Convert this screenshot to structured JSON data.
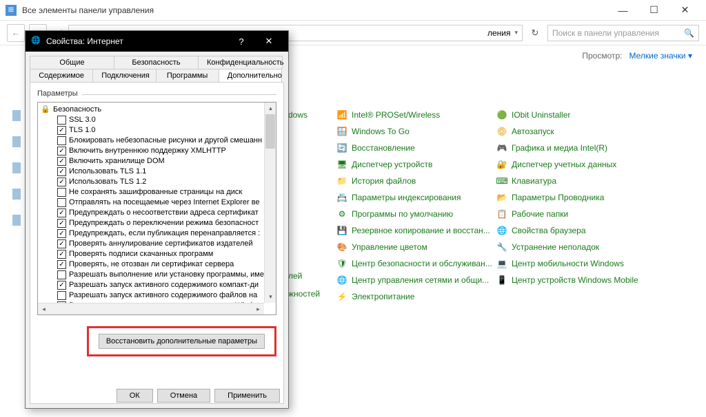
{
  "cp": {
    "title": "Все элементы панели управления",
    "addr_tail": "ления",
    "search_placeholder": "Поиск в панели управления",
    "view_label": "Просмотр:",
    "view_value": "Мелкие значки",
    "cut_items": [
      "dows",
      "",
      "",
      "",
      "",
      "",
      "",
      "",
      "",
      "лей",
      "жностей",
      "",
      ""
    ],
    "col1": [
      {
        "icon": "📶",
        "label": "Intel® PROSet/Wireless"
      },
      {
        "icon": "🪟",
        "label": "Windows To Go"
      },
      {
        "icon": "🔄",
        "label": "Восстановление"
      },
      {
        "icon": "🖥",
        "label": "Диспетчер устройств"
      },
      {
        "icon": "📁",
        "label": "История файлов"
      },
      {
        "icon": "📇",
        "label": "Параметры индексирования"
      },
      {
        "icon": "⚙",
        "label": "Программы по умолчанию"
      },
      {
        "icon": "💾",
        "label": "Резервное копирование и восстан..."
      },
      {
        "icon": "🎨",
        "label": "Управление цветом"
      },
      {
        "icon": "🛡",
        "label": "Центр безопасности и обслуживан..."
      },
      {
        "icon": "🌐",
        "label": "Центр управления сетями и общи..."
      },
      {
        "icon": "⚡",
        "label": "Электропитание"
      }
    ],
    "col2": [
      {
        "icon": "🟢",
        "label": "IObit Uninstaller"
      },
      {
        "icon": "📀",
        "label": "Автозапуск"
      },
      {
        "icon": "🎮",
        "label": "Графика и медиа Intel(R)"
      },
      {
        "icon": "🔐",
        "label": "Диспетчер учетных данных"
      },
      {
        "icon": "⌨",
        "label": "Клавиатура"
      },
      {
        "icon": "📂",
        "label": "Параметры Проводника"
      },
      {
        "icon": "📋",
        "label": "Рабочие папки"
      },
      {
        "icon": "🌐",
        "label": "Свойства браузера"
      },
      {
        "icon": "🔧",
        "label": "Устранение неполадок"
      },
      {
        "icon": "💻",
        "label": "Центр мобильности Windows"
      },
      {
        "icon": "📱",
        "label": "Центр устройств Windows Mobile"
      }
    ]
  },
  "dlg": {
    "title": "Свойства: Интернет",
    "tabs_row1": [
      "Общие",
      "Безопасность",
      "Конфиденциальность"
    ],
    "tabs_row2": [
      "Содержимое",
      "Подключения",
      "Программы",
      "Дополнительно"
    ],
    "group": "Параметры",
    "section": "Безопасность",
    "opts": [
      {
        "c": false,
        "t": "SSL 3.0"
      },
      {
        "c": true,
        "t": "TLS 1.0"
      },
      {
        "c": false,
        "t": "Блокировать небезопасные рисунки и другой смешанн"
      },
      {
        "c": true,
        "t": "Включить внутреннюю поддержку XMLHTTP"
      },
      {
        "c": true,
        "t": "Включить хранилище DOM"
      },
      {
        "c": true,
        "t": "Использовать TLS 1.1"
      },
      {
        "c": true,
        "t": "Использовать TLS 1.2"
      },
      {
        "c": false,
        "t": "Не сохранять зашифрованные страницы на диск"
      },
      {
        "c": false,
        "t": "Отправлять на посещаемые через Internet Explorer ве"
      },
      {
        "c": true,
        "t": "Предупреждать о несоответствии адреса сертификат"
      },
      {
        "c": true,
        "t": "Предупреждать о переключении режима безопасност"
      },
      {
        "c": true,
        "t": "Предупреждать, если публикация перенаправляется :"
      },
      {
        "c": true,
        "t": "Проверять аннулирование сертификатов издателей"
      },
      {
        "c": true,
        "t": "Проверять подписи скачанных программ"
      },
      {
        "c": true,
        "t": "Проверять, не отозван ли сертификат сервера"
      },
      {
        "c": false,
        "t": "Разрешать выполнение или установку программы, име"
      },
      {
        "c": true,
        "t": "Разрешать запуск активного содержимого компакт-ди"
      },
      {
        "c": false,
        "t": "Разрешать запуск активного содержимого файлов на"
      },
      {
        "c": true,
        "t": "Разрешить встроенную проверку подлинности Window"
      }
    ],
    "restore_btn": "Восстановить дополнительные параметры",
    "ok": "ОК",
    "cancel": "Отмена",
    "apply": "Применить"
  }
}
